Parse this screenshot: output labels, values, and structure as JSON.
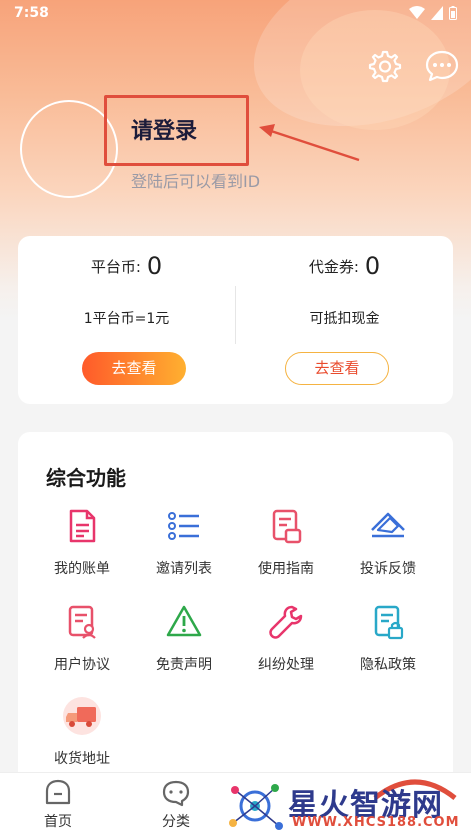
{
  "status_bar": {
    "time": "7:58"
  },
  "profile": {
    "login_title": "请登录",
    "login_subtitle": "登陆后可以看到ID"
  },
  "coins": {
    "platform": {
      "label": "平台币:",
      "value": "0",
      "note": "1平台币=1元",
      "button": "去查看"
    },
    "voucher": {
      "label": "代金券:",
      "value": "0",
      "note": "可抵扣现金",
      "button": "去查看"
    }
  },
  "functions": {
    "title": "综合功能",
    "items": [
      {
        "label": "我的账单",
        "icon": "bill-icon"
      },
      {
        "label": "邀请列表",
        "icon": "list-icon"
      },
      {
        "label": "使用指南",
        "icon": "guide-icon"
      },
      {
        "label": "投诉反馈",
        "icon": "feedback-icon"
      },
      {
        "label": "用户协议",
        "icon": "agreement-icon"
      },
      {
        "label": "免责声明",
        "icon": "warning-icon"
      },
      {
        "label": "纠纷处理",
        "icon": "wrench-icon"
      },
      {
        "label": "隐私政策",
        "icon": "privacy-icon"
      },
      {
        "label": "收货地址",
        "icon": "delivery-truck-icon"
      }
    ]
  },
  "tabbar": {
    "items": [
      {
        "label": "首页",
        "icon": "home-icon"
      },
      {
        "label": "分类",
        "icon": "category-icon"
      }
    ]
  },
  "watermark": {
    "text": "星火智游网",
    "url": "WWW.XHCS188.COM"
  },
  "colors": {
    "accent_red": "#e04e3c",
    "accent_orange": "#ffb030",
    "icon_pink": "#e8356b",
    "icon_blue": "#3a6fd8",
    "icon_green": "#2ea84a",
    "icon_cyan": "#29a8c8"
  }
}
